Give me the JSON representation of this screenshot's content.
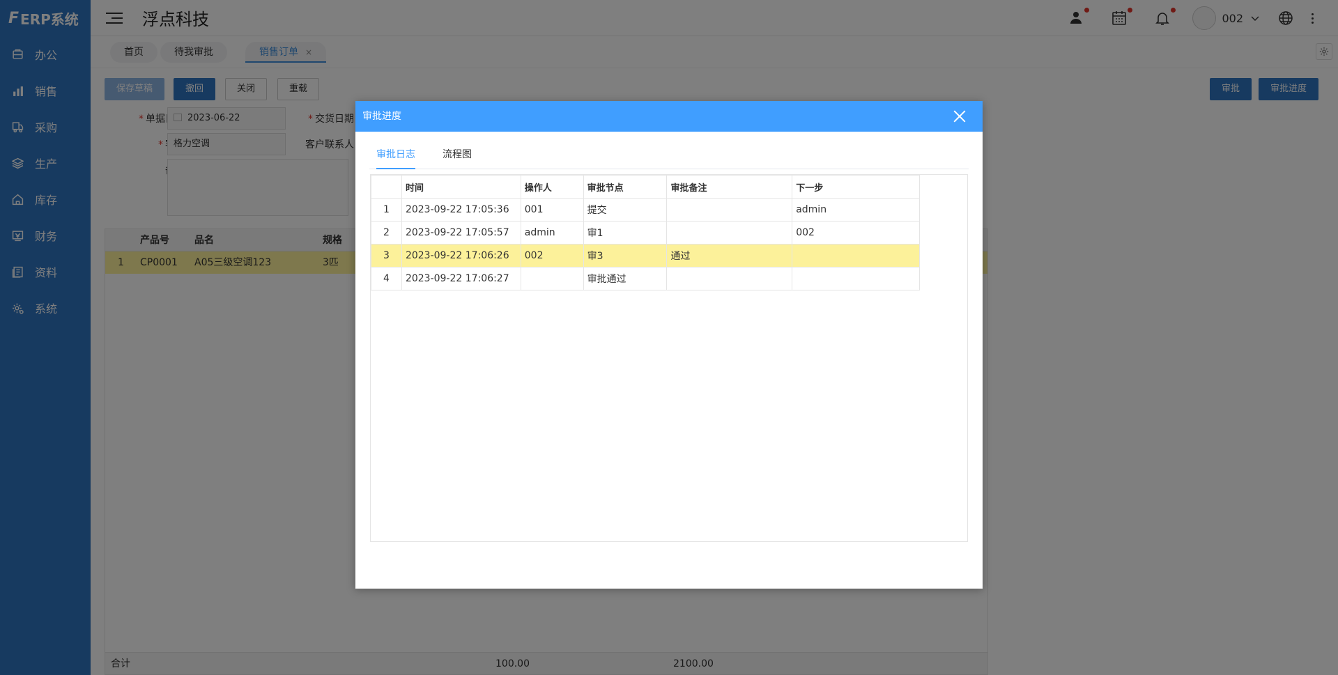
{
  "app": {
    "logo_text": "ERP系统",
    "company": "浮点科技"
  },
  "sidebar": {
    "items": [
      {
        "label": "办公",
        "icon": "office-icon"
      },
      {
        "label": "销售",
        "icon": "sales-icon"
      },
      {
        "label": "采购",
        "icon": "purchase-icon"
      },
      {
        "label": "生产",
        "icon": "production-icon"
      },
      {
        "label": "库存",
        "icon": "inventory-icon"
      },
      {
        "label": "财务",
        "icon": "finance-icon"
      },
      {
        "label": "资料",
        "icon": "data-icon"
      },
      {
        "label": "系统",
        "icon": "system-icon"
      }
    ]
  },
  "header": {
    "username": "002"
  },
  "tabs": [
    {
      "label": "首页"
    },
    {
      "label": "待我审批"
    },
    {
      "label": "销售订单",
      "close": "×"
    }
  ],
  "toolbar": {
    "save_draft": "保存草稿",
    "withdraw": "撤回",
    "close": "关闭",
    "reload": "重载",
    "approve": "审批",
    "approval_progress": "审批进度"
  },
  "form": {
    "doc_date_label": "单据日期",
    "doc_date_value": "2023-06-22",
    "delivery_date_label": "交货日期",
    "customer_label": "客户",
    "customer_value": "格力空调",
    "contact_label": "客户联系人",
    "remark_label": "备注",
    "required_mark": "*"
  },
  "grid": {
    "headers": {
      "product_no": "产品号",
      "name": "品名",
      "spec": "规格"
    },
    "row": {
      "idx": "1",
      "product_no": "CP0001",
      "name": "A05三级空调123",
      "spec": "3匹"
    },
    "footer": {
      "label": "合计",
      "qty": "100.00",
      "amount": "2100.00"
    }
  },
  "modal": {
    "title": "审批进度",
    "tabs": [
      "审批日志",
      "流程图"
    ],
    "columns": [
      "时间",
      "操作人",
      "审批节点",
      "审批备注",
      "下一步"
    ],
    "rows": [
      {
        "idx": "1",
        "time": "2023-09-22 17:05:36",
        "operator": "001",
        "node": "提交",
        "remark": "",
        "next": "admin"
      },
      {
        "idx": "2",
        "time": "2023-09-22 17:05:57",
        "operator": "admin",
        "node": "审1",
        "remark": "",
        "next": "002"
      },
      {
        "idx": "3",
        "time": "2023-09-22 17:06:26",
        "operator": "002",
        "node": "审3",
        "remark": "通过",
        "next": ""
      },
      {
        "idx": "4",
        "time": "2023-09-22 17:06:27",
        "operator": "",
        "node": "审批通过",
        "remark": "",
        "next": ""
      }
    ],
    "highlight_row": 2
  },
  "colors": {
    "sidebar": "#2f74c0",
    "modal_header": "#409eff",
    "highlight": "#fcf19a",
    "badge": "#e0342b"
  }
}
